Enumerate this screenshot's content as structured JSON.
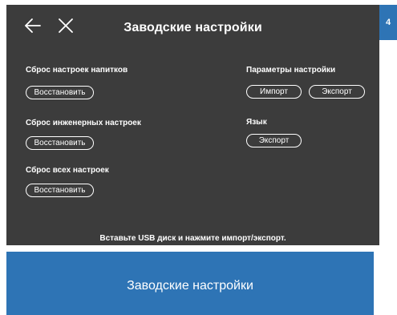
{
  "screen": {
    "title": "Заводские настройки",
    "back_icon": "arrow-left-icon",
    "close_icon": "close-icon"
  },
  "badge": "4",
  "reset_sections": [
    {
      "label": "Сброс настроек напитков",
      "button": "Восстановить"
    },
    {
      "label": "Сброс инженерных настроек",
      "button": "Восстановить"
    },
    {
      "label": "Сброс всех настроек",
      "button": "Восстановить"
    }
  ],
  "settings_params": {
    "label": "Параметры настройки",
    "import_button": "Импорт",
    "export_button": "Экспорт"
  },
  "language": {
    "label": "Язык",
    "export_button": "Экспорт"
  },
  "hint": "Вставьте USB диск и нажмите импорт/экспорт.",
  "footer": {
    "caption": "Заводские настройки"
  }
}
